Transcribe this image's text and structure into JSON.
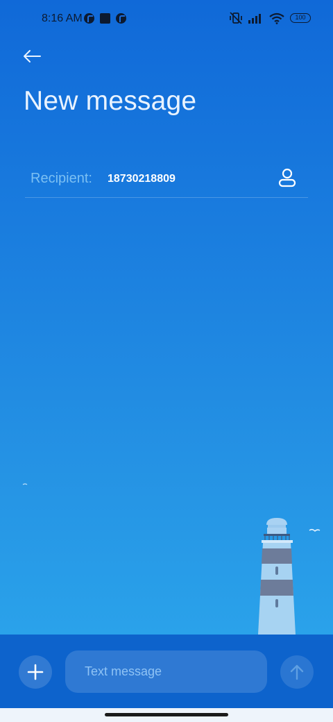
{
  "status_bar": {
    "time": "8:16 AM",
    "battery": "100"
  },
  "header": {
    "title": "New message",
    "back_icon": "arrow-left-icon"
  },
  "recipient": {
    "label": "Recipient:",
    "value": "18730218809",
    "contact_icon": "person-icon"
  },
  "composer": {
    "placeholder": "Text message",
    "attach_icon": "plus-icon",
    "send_icon": "arrow-up-icon"
  },
  "colors": {
    "background_top": "#1069d8",
    "background_bottom": "#2aa2ea",
    "bottom_bar": "#0d63cc",
    "recipient_label": "#7cc0f3"
  }
}
